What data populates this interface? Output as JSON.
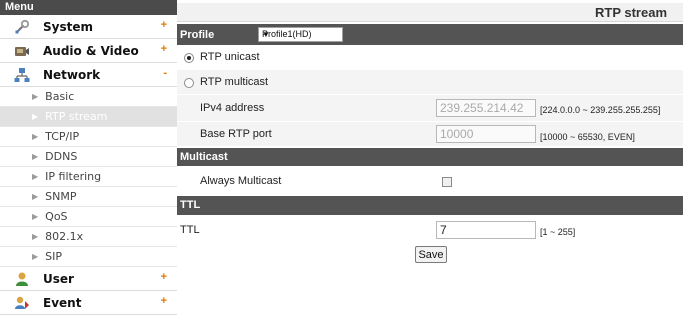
{
  "sidebar": {
    "header": "Menu",
    "system": {
      "label": "System",
      "mark": "+",
      "icon": "tools-icon"
    },
    "audio_video": {
      "label": "Audio & Video",
      "mark": "+",
      "icon": "camera-icon"
    },
    "network": {
      "label": "Network",
      "mark": "-",
      "icon": "network-icon",
      "items": [
        "Basic",
        "RTP stream",
        "TCP/IP",
        "DDNS",
        "IP filtering",
        "SNMP",
        "QoS",
        "802.1x",
        "SIP"
      ],
      "active": "RTP stream"
    },
    "user": {
      "label": "User",
      "mark": "+",
      "icon": "user-icon"
    },
    "event": {
      "label": "Event",
      "mark": "+",
      "icon": "event-icon"
    }
  },
  "main": {
    "title": "RTP stream",
    "profile": {
      "label": "Profile",
      "selected": "Profile1(HD)"
    },
    "rtp_unicast": {
      "label": "RTP unicast",
      "checked": true
    },
    "rtp_multicast": {
      "label": "RTP multicast",
      "checked": false
    },
    "ipv4": {
      "label": "IPv4 address",
      "value": "239.255.214.42",
      "hint": "[224.0.0.0 ~ 239.255.255.255]"
    },
    "base_port": {
      "label": "Base RTP port",
      "value": "10000",
      "hint": "[10000 ~ 65530, EVEN]"
    },
    "multicast_section": "Multicast",
    "always_multicast": {
      "label": "Always Multicast",
      "checked": false
    },
    "ttl_section": "TTL",
    "ttl": {
      "label": "TTL",
      "value": "7",
      "hint": "[1 ~ 255]"
    },
    "save_label": "Save"
  },
  "colors": {
    "section_bar": "#545454",
    "menu_header": "#4b4b4b",
    "expand_mark": "#e07a00",
    "active_item": "#e1e1e1"
  }
}
